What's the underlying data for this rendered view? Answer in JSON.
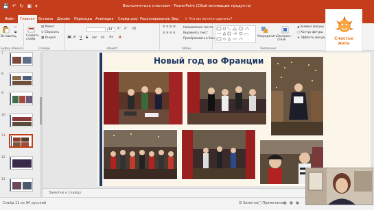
{
  "window": {
    "title": "Восполнятель счастьем - PowerPoint (Сбой активации продукта)"
  },
  "tabs": [
    {
      "label": "Файл"
    },
    {
      "label": "Главная"
    },
    {
      "label": "Вставка"
    },
    {
      "label": "Дизайн"
    },
    {
      "label": "Переходы"
    },
    {
      "label": "Анимация"
    },
    {
      "label": "Слайд-шоу"
    },
    {
      "label": "Рецензирование"
    },
    {
      "label": "Вид"
    }
  ],
  "tell_me": "Что вы хотите сделать?",
  "ribbon": {
    "clipboard": {
      "paste": "Вставить",
      "cut": "Вырезать",
      "copy": "Копировать",
      "label": "Буфер обмена"
    },
    "slides": {
      "new": "Создать слайд",
      "layout": "Макет",
      "reset": "Сбросить",
      "section": "Раздел",
      "label": "Слайды"
    },
    "font": {
      "name": "",
      "size": "44",
      "label": "Шрифт",
      "bold": "Ж",
      "italic": "К",
      "underline": "Ч",
      "strike": "S",
      "shadow": "abc",
      "spacing": "AV",
      "case": "Aa"
    },
    "paragraph": {
      "direction": "Направление текста",
      "align": "Выровнять текст",
      "smartart": "Преобразовать в SmartArt",
      "label": "Абзац"
    },
    "drawing": {
      "arrange": "Упорядочить",
      "styles": "Экспресс-стили",
      "fill": "Заливка фигуры",
      "outline": "Контур фигуры",
      "effects": "Эффекты фигуры",
      "label": "Рисование"
    }
  },
  "logo": {
    "line1": "Счастье",
    "line2": "жить"
  },
  "thumbnails": [
    {
      "num": "7"
    },
    {
      "num": "8"
    },
    {
      "num": "9"
    },
    {
      "num": "10"
    },
    {
      "num": "11"
    },
    {
      "num": "12"
    },
    {
      "num": "13"
    }
  ],
  "slide": {
    "title": "Новый год во Франции"
  },
  "notes": {
    "placeholder": "Заметки к слайду"
  },
  "status": {
    "slide_count": "Слайд 11 из 34",
    "language": "русский",
    "notes": "Заметки",
    "comments": "Примечания"
  }
}
